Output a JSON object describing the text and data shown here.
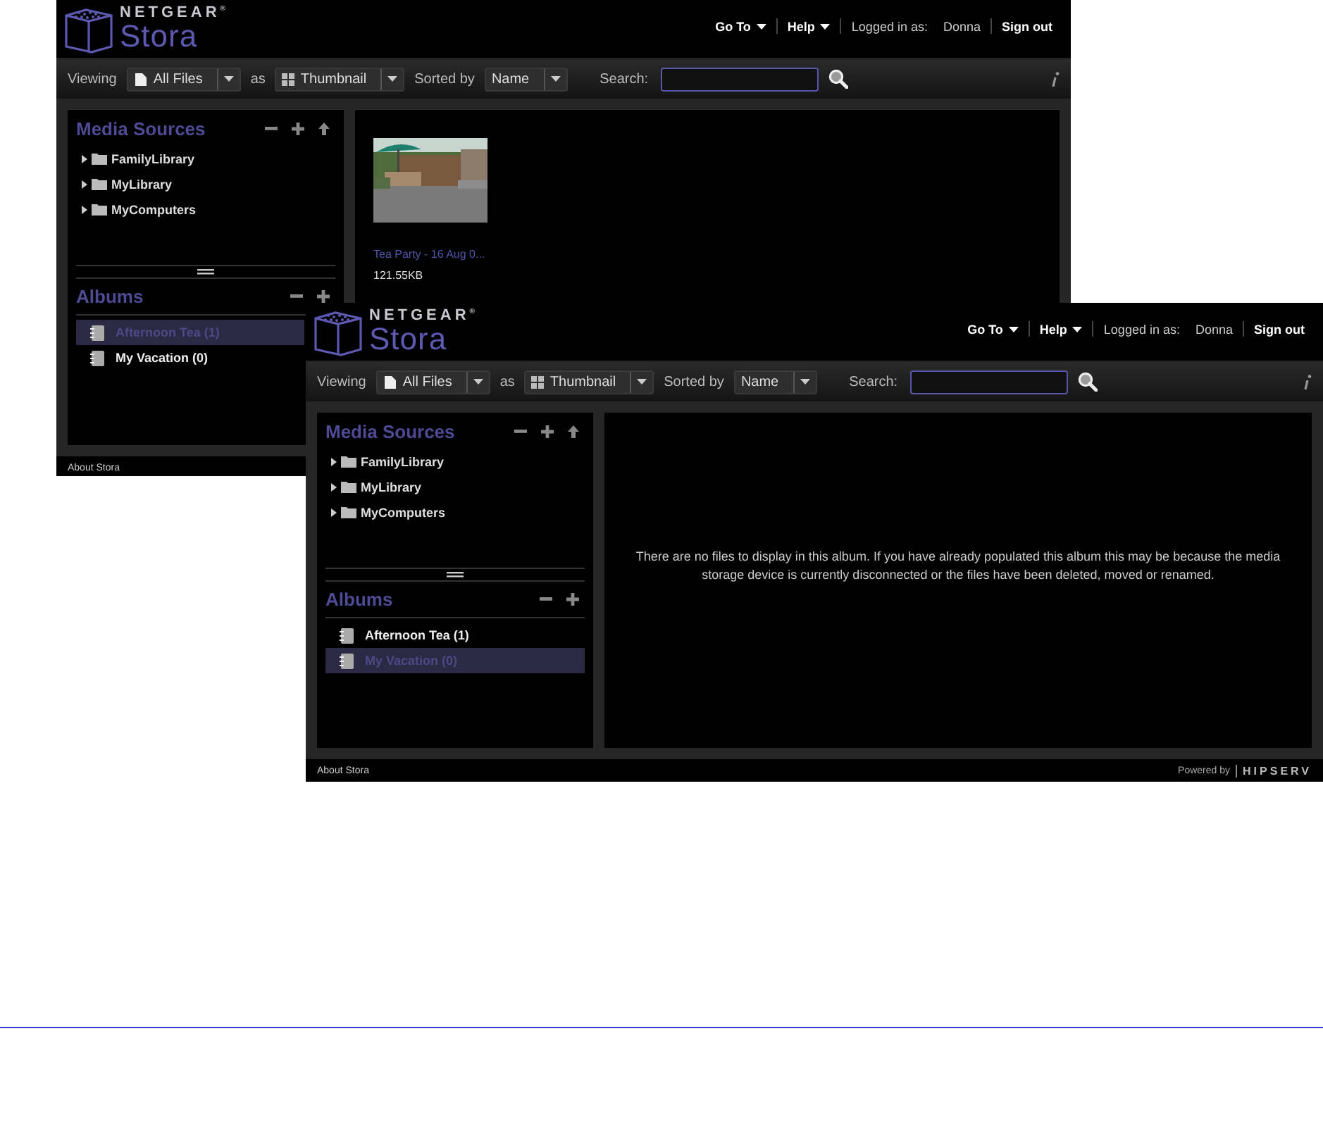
{
  "windows": [
    {
      "header": {
        "brand": "NETGEAR$^{®}$",
        "product": "Stora",
        "nav": [
          {
            "kind": "menu",
            "label": "Go To"
          },
          {
            "kind": "menu",
            "label": "Help"
          },
          {
            "kind": "text",
            "label": "Logged in as:"
          },
          {
            "kind": "user",
            "label": "Donna"
          },
          {
            "kind": "link",
            "label": "Sign out"
          }
        ]
      },
      "toolbar": {
        "viewing_label": "Viewing",
        "view": "All Files",
        "as_label": "as",
        "layout": "Thumbnail",
        "sorted_label": "Sorted by",
        "sort": "Name",
        "search_label": "Search:"
      },
      "media_sources": {
        "title": "Media Sources",
        "items": [
          {
            "label": "FamilyLibrary",
            "expanded": false
          },
          {
            "label": "MyLibrary",
            "expanded": false
          },
          {
            "label": "MyComputers",
            "expanded": false
          }
        ]
      },
      "albums": {
        "title": "Albums",
        "items": [
          {
            "label": "Afternoon Tea (1)",
            "selected": true
          },
          {
            "label": "My Vacation (0)",
            "selected": false
          }
        ]
      },
      "content": {
        "kind": "thumbnails",
        "items": [
          {
            "kind": "picture",
            "caption": "Tea Party - 16 Aug 0...",
            "size": "121.55KB"
          }
        ]
      },
      "footer": {
        "about": "About Stora"
      }
    },
    {
      "header": {
        "brand": "NETGEAR$^{®}$",
        "product": "Stora",
        "nav": [
          {
            "kind": "menu",
            "label": "Go To"
          },
          {
            "kind": "menu",
            "label": "Help"
          },
          {
            "kind": "text",
            "label": "Logged in as:"
          },
          {
            "kind": "user",
            "label": "Donna"
          },
          {
            "kind": "link",
            "label": "Sign out"
          }
        ]
      },
      "toolbar": {
        "viewing_label": "Viewing",
        "view": "All Files",
        "as_label": "as",
        "layout": "Thumbnail",
        "sorted_label": "Sorted by",
        "sort": "Name",
        "search_label": "Search:"
      },
      "media_sources": {
        "title": "Media Sources",
        "items": [
          {
            "label": "FamilyLibrary",
            "expanded": false
          },
          {
            "label": "MyLibrary",
            "expanded": false
          },
          {
            "label": "MyComputers",
            "expanded": false
          }
        ]
      },
      "albums": {
        "title": "Albums",
        "items": [
          {
            "label": "Afternoon Tea (1)",
            "selected": false
          },
          {
            "label": "My Vacation (0)",
            "selected": true
          }
        ]
      },
      "content": {
        "kind": "message",
        "text": "There are no files to display in this album. If you have already populated this album this may be because the media storage device is currently disconnected or the files have been deleted, moved or renamed."
      },
      "footer": {
        "about": "About Stora",
        "powered_by": "Powered by",
        "powered_brand": "HIPSERV"
      }
    }
  ]
}
